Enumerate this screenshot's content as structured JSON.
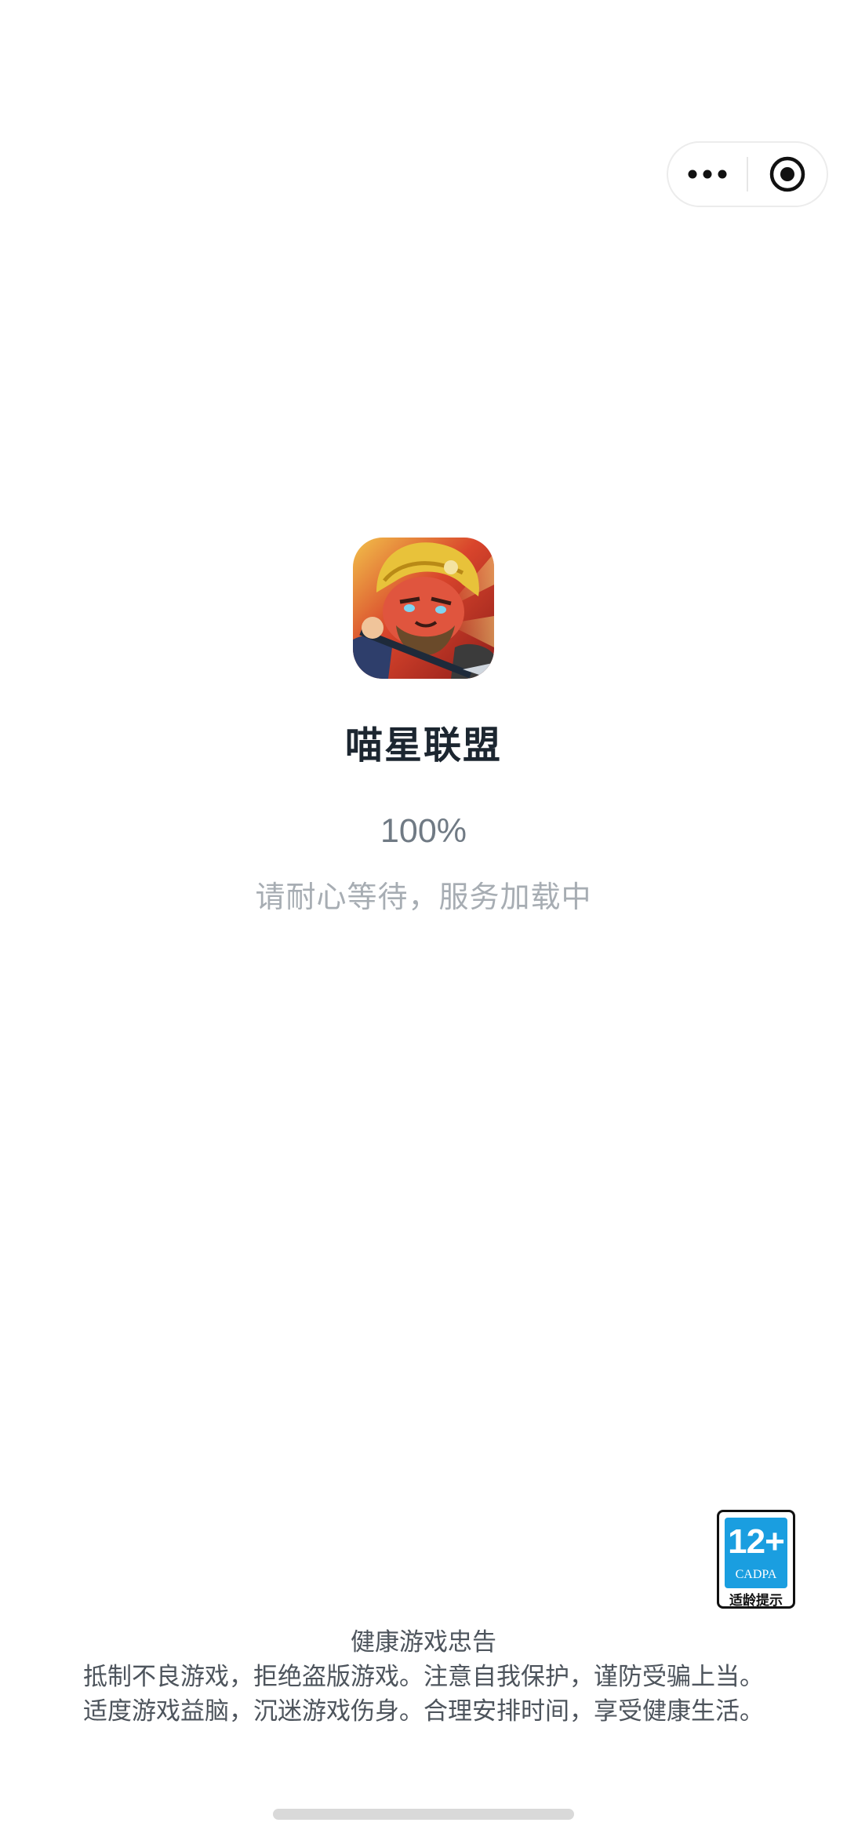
{
  "capsule": {
    "more_icon": "more-dots-icon",
    "close_icon": "target-circle-icon"
  },
  "app": {
    "name": "喵星联盟",
    "icon": "game-character-icon"
  },
  "loading": {
    "progress": "100%",
    "progress_value": 1.0,
    "message": "请耐心等待，服务加载中"
  },
  "age_rating": {
    "age": "12+",
    "org": "CADPA",
    "tip": "适龄提示",
    "color": "#1a9ee0"
  },
  "health_notice": {
    "title": "健康游戏忠告",
    "line1": "抵制不良游戏，拒绝盗版游戏。注意自我保护，谨防受骗上当。",
    "line2": "适度游戏益脑，沉迷游戏伤身。合理安排时间，享受健康生活。"
  }
}
